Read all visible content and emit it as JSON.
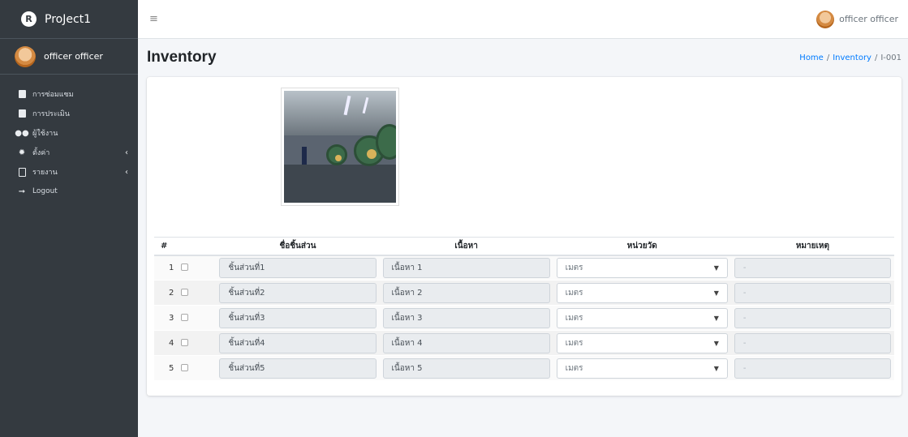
{
  "brand": {
    "logo_letter": "R",
    "name": "ProJect1"
  },
  "user": {
    "name": "officer officer"
  },
  "sidebar": {
    "items": [
      {
        "icon": "clipboard-icon",
        "label": "การซ่อมแซม",
        "caret": ""
      },
      {
        "icon": "check-square-icon",
        "label": "การประเมิน",
        "caret": ""
      },
      {
        "icon": "users-icon",
        "label": "ผู้ใช้งาน",
        "caret": ""
      },
      {
        "icon": "gear-icon",
        "label": "ตั้งค่า",
        "caret": "‹"
      },
      {
        "icon": "file-report-icon",
        "label": "รายงาน",
        "caret": "‹"
      },
      {
        "icon": "logout-icon",
        "label": "Logout",
        "caret": ""
      }
    ]
  },
  "topbar": {
    "menu_icon": "≡",
    "user_name": "officer officer"
  },
  "page": {
    "title": "Inventory",
    "breadcrumb": [
      "Home",
      "/",
      "Inventory",
      "/",
      "I-001"
    ]
  },
  "table": {
    "headers": [
      "#",
      "ชื่อชิ้นส่วน",
      "เนื้อหา",
      "หน่วยวัด",
      "หมายเหตุ"
    ],
    "rows": [
      {
        "no": "1",
        "part": "ชิ้นส่วนที่1",
        "content": "เนื้อหา 1",
        "unit": "เมตร",
        "note": "-"
      },
      {
        "no": "2",
        "part": "ชิ้นส่วนที่2",
        "content": "เนื้อหา 2",
        "unit": "เมตร",
        "note": "-"
      },
      {
        "no": "3",
        "part": "ชิ้นส่วนที่3",
        "content": "เนื้อหา 3",
        "unit": "เมตร",
        "note": "-"
      },
      {
        "no": "4",
        "part": "ชิ้นส่วนที่4",
        "content": "เนื้อหา 4",
        "unit": "เมตร",
        "note": "-"
      },
      {
        "no": "5",
        "part": "ชิ้นส่วนที่5",
        "content": "เนื้อหา 5",
        "unit": "เมตร",
        "note": "-"
      }
    ]
  },
  "colors": {
    "sidebar_bg": "#343a40",
    "link": "#007bff",
    "content_bg": "#f4f6f9"
  }
}
